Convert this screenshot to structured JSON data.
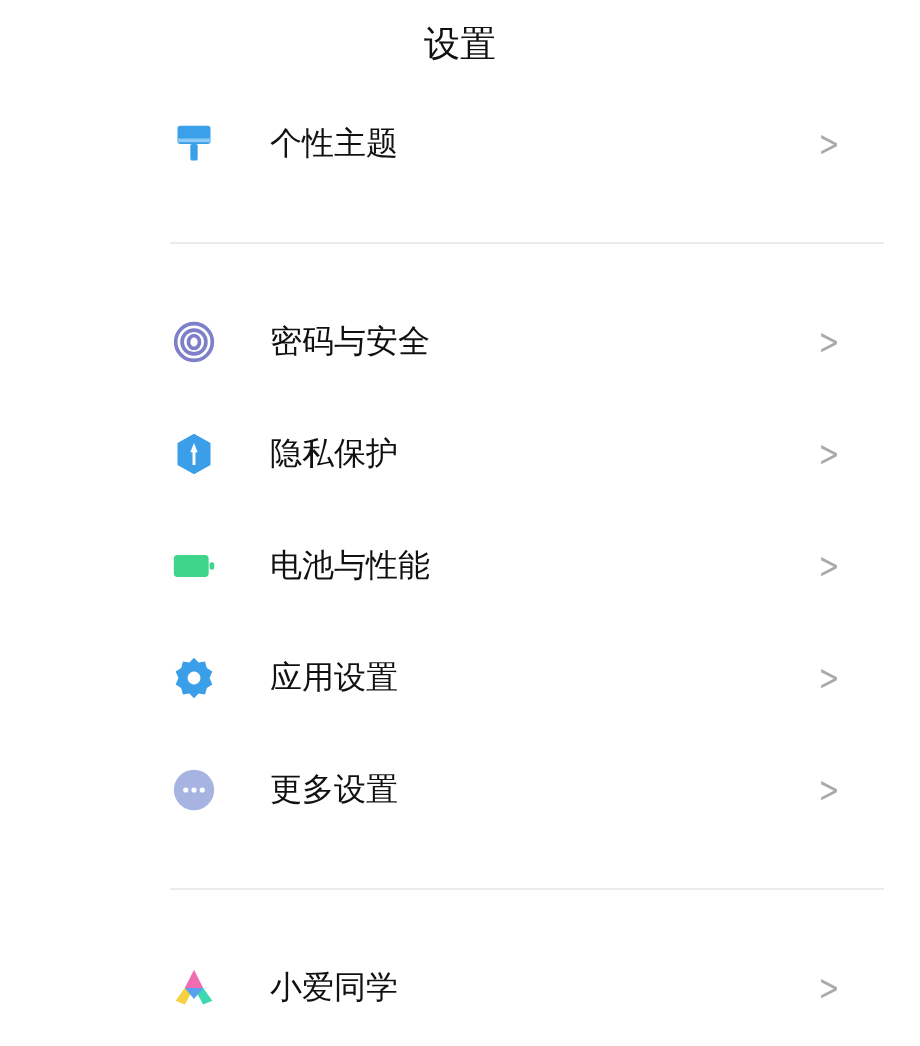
{
  "title": "设置",
  "sections": [
    {
      "items": [
        {
          "kind": "theme",
          "label": "个性主题",
          "chevron": ">"
        }
      ]
    },
    {
      "items": [
        {
          "kind": "fingerprint",
          "label": "密码与安全",
          "chevron": ">"
        },
        {
          "kind": "privacy",
          "label": "隐私保护",
          "chevron": ">"
        },
        {
          "kind": "battery",
          "label": "电池与性能",
          "chevron": ">"
        },
        {
          "kind": "gear",
          "label": "应用设置",
          "chevron": ">"
        },
        {
          "kind": "more",
          "label": "更多设置",
          "chevron": ">"
        }
      ]
    },
    {
      "items": [
        {
          "kind": "assistant",
          "label": "小爱同学",
          "chevron": ">"
        }
      ]
    }
  ]
}
